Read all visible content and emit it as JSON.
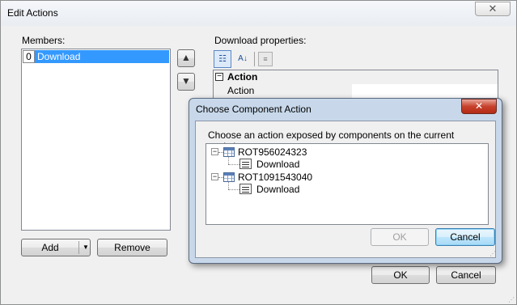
{
  "outer_dialog": {
    "title": "Edit Actions",
    "close_glyph": "✕",
    "members_label": "Members:",
    "members": [
      {
        "index": "0",
        "name": "Download"
      }
    ],
    "up_arrow": "▲",
    "down_arrow": "▼",
    "add_label": "Add",
    "add_dropdown": "▼",
    "remove_label": "Remove",
    "properties_label": "Download properties:",
    "toolbar": {
      "categorized_icon": "categorized-icon",
      "alphabetical_icon": "alphabetical-icon",
      "property_pages_icon": "property-pages-icon"
    },
    "property_grid": {
      "category_toggle": "−",
      "category": "Action",
      "rows": [
        {
          "name": "Action",
          "value": ""
        }
      ]
    },
    "ok_label": "OK",
    "cancel_label": "Cancel"
  },
  "inner_dialog": {
    "title": "Choose Component Action",
    "close_glyph": "✕",
    "description": "Choose an action exposed by components on the current worksheet.",
    "tree": [
      {
        "toggle": "−",
        "label": "ROT956024323",
        "children": [
          {
            "label": "Download"
          }
        ]
      },
      {
        "toggle": "−",
        "label": "ROT1091543040",
        "children": [
          {
            "label": "Download"
          }
        ]
      }
    ],
    "ok_label": "OK",
    "cancel_label": "Cancel"
  },
  "colors": {
    "selection": "#3399ff",
    "dialog_bg": "#f0f0f0",
    "inner_frame": "#c8d8ea",
    "close_red": "#c7422d"
  }
}
